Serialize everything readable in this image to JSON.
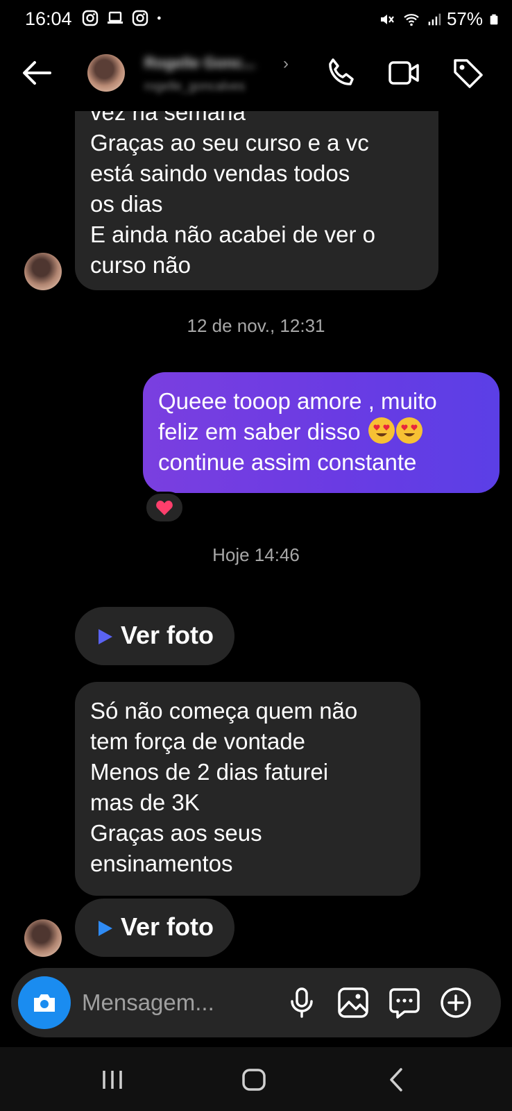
{
  "status_bar": {
    "time": "16:04",
    "battery": "57%",
    "left_icons": [
      "instagram-icon",
      "laptop-icon",
      "instagram-icon",
      "dot-icon"
    ],
    "right_icons": [
      "mute-icon",
      "wifi-icon",
      "signal-icon",
      "battery-icon"
    ]
  },
  "header": {
    "contact_name": "Rogelle Gonc...",
    "contact_username": "rogelle_goncalves",
    "chevron": "›",
    "icons": [
      "back-arrow-icon",
      "phone-icon",
      "video-icon",
      "tag-icon"
    ]
  },
  "messages": [
    {
      "id": "m1",
      "direction": "incoming",
      "lines": [
        "vez na semana",
        "Graças ao seu curso e a vc",
        "está saindo vendas todos",
        "os dias",
        "E ainda não acabei de ver o",
        "curso não"
      ]
    },
    {
      "id": "t1",
      "type": "timestamp",
      "text": "12 de nov., 12:31"
    },
    {
      "id": "m2",
      "direction": "outgoing",
      "lines": [
        "Queee tooop amore , muito",
        "feliz em saber disso",
        "continue assim constante"
      ],
      "emojis": [
        "heart-eyes-emoji",
        "heart-eyes-emoji"
      ],
      "reaction": "heart-icon"
    },
    {
      "id": "t2",
      "type": "timestamp",
      "text": "Hoje 14:46"
    },
    {
      "id": "m3",
      "direction": "incoming",
      "type": "photo",
      "label": "Ver foto"
    },
    {
      "id": "m4",
      "direction": "incoming",
      "lines": [
        "Só não começa quem não",
        "tem força de vontade",
        "Menos de 2 dias faturei",
        "mas de 3K",
        "Graças aos seus",
        "ensinamentos"
      ]
    },
    {
      "id": "m5",
      "direction": "incoming",
      "type": "photo",
      "label": "Ver foto"
    }
  ],
  "composer": {
    "placeholder": "Mensagem...",
    "value": "",
    "icons": [
      "camera-icon",
      "microphone-icon",
      "gallery-icon",
      "sticker-icon",
      "plus-icon"
    ]
  },
  "nav_bar": {
    "icons": [
      "recent-apps-icon",
      "home-icon",
      "back-icon"
    ]
  },
  "colors": {
    "background": "#000000",
    "incoming_bubble": "#262626",
    "outgoing_gradient_start": "#7a3fe0",
    "outgoing_gradient_end": "#5b3fe6",
    "camera_button": "#1a8cf0",
    "timestamp_text": "#a8a8a8",
    "placeholder_text": "#a0a0a0"
  }
}
